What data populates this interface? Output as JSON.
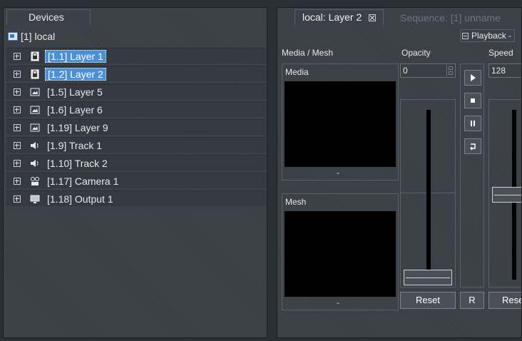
{
  "devices": {
    "tab_label": "Devices",
    "root": {
      "label": "[1] local",
      "icon": "computer-icon"
    },
    "items": [
      {
        "label": "[1.1] Layer 1",
        "icon": "layer-lock-icon",
        "selected": true
      },
      {
        "label": "[1.2] Layer 2",
        "icon": "layer-lock-icon",
        "selected": true
      },
      {
        "label": "[1.5] Layer 5",
        "icon": "layer-image-icon",
        "selected": false
      },
      {
        "label": "[1.6] Layer 6",
        "icon": "layer-image-icon",
        "selected": false
      },
      {
        "label": "[1.19] Layer 9",
        "icon": "layer-image-icon",
        "selected": false
      },
      {
        "label": "[1.9] Track 1",
        "icon": "speaker-icon",
        "selected": false
      },
      {
        "label": "[1.10] Track 2",
        "icon": "speaker-icon",
        "selected": false
      },
      {
        "label": "[1.17] Camera 1",
        "icon": "camera-icon",
        "selected": false
      },
      {
        "label": "[1.18] Output 1",
        "icon": "monitor-icon",
        "selected": false
      }
    ]
  },
  "editor": {
    "active_tab": "local: Layer 2",
    "inactive_tab": "Sequence: [1] unname",
    "playback_label": "Playback -",
    "headers": {
      "media_mesh": "Media / Mesh",
      "opacity": "Opacity",
      "speed": "Speed"
    },
    "media": {
      "label": "Media",
      "value": "-"
    },
    "mesh": {
      "label": "Mesh",
      "value": "-"
    },
    "opacity": {
      "value": "0",
      "reset_label": "Reset"
    },
    "speed": {
      "value": "128",
      "reset_label": "Rese"
    },
    "transport": {
      "r_label": "R"
    }
  },
  "colors": {
    "selection": "#4a8fd8",
    "background": "#3a3e45"
  }
}
